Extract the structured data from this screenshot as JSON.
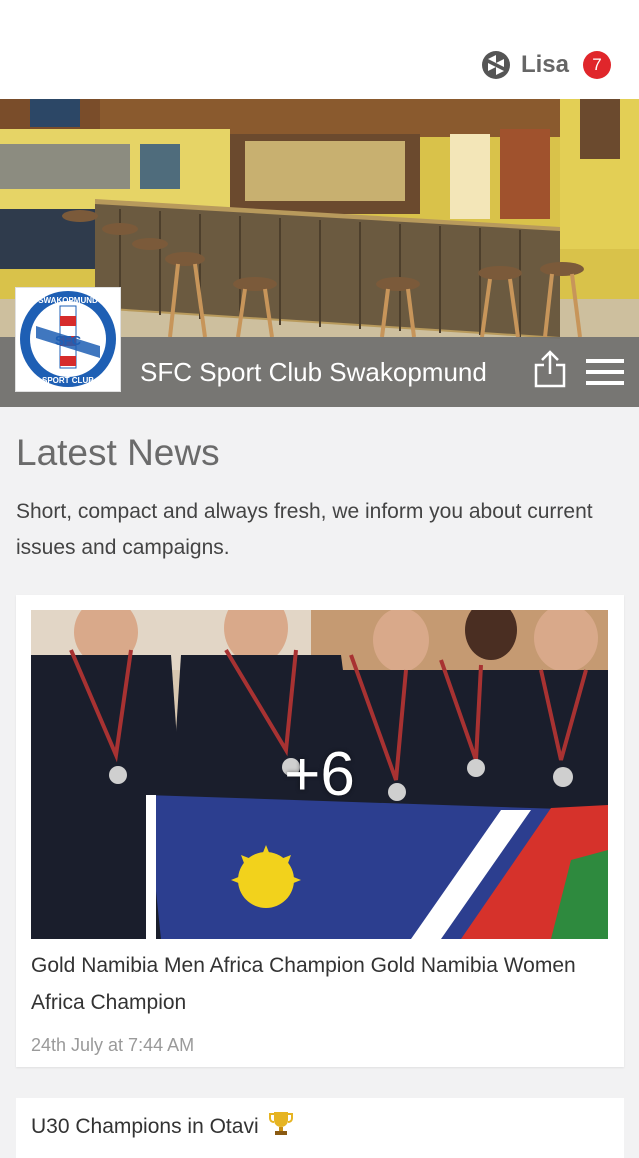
{
  "header": {
    "user_name": "Lisa",
    "notification_count": "7",
    "user_icon": "user-logo-icon"
  },
  "hero": {
    "club_name": "SFC Sport Club Swakopmund",
    "logo": {
      "top_text": "SWAKOPMUND",
      "bottom_text": "SPORT CLUB",
      "center_text": "SFC"
    },
    "share_icon": "share-icon",
    "menu_icon": "menu-icon"
  },
  "news": {
    "title": "Latest News",
    "description": "Short, compact and always fresh, we inform you about current issues and campaigns.",
    "items": [
      {
        "photo_count": "+6",
        "title": "Gold Namibia Men Africa Champion Gold Namibia Women Africa Champion",
        "date": "24th July at 7:44 AM"
      },
      {
        "title": "U30 Champions in Otavi",
        "icon": "trophy-icon"
      }
    ]
  },
  "colors": {
    "badge": "#e0262b",
    "hero_bar": "#6e6e6e",
    "flag_blue": "#2c3e8f",
    "flag_red": "#d6322b",
    "flag_green": "#2e8a3e",
    "flag_sun": "#f2d21c"
  }
}
